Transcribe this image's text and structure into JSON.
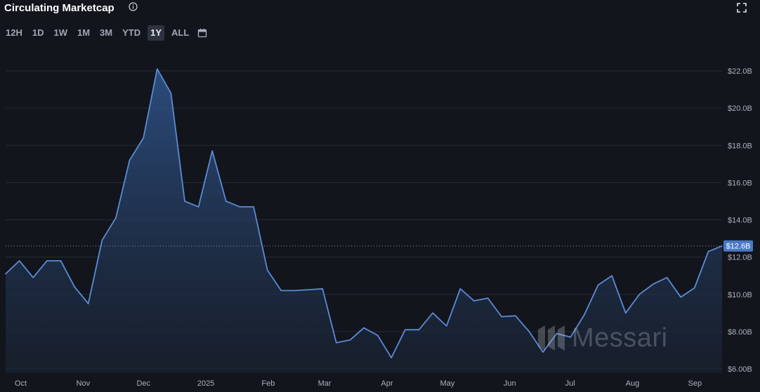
{
  "header": {
    "title": "Circulating Marketcap",
    "info_icon": "info-circle-icon",
    "expand_icon": "fullscreen-icon"
  },
  "range_buttons": [
    "12H",
    "1D",
    "1W",
    "1M",
    "3M",
    "YTD",
    "1Y",
    "ALL"
  ],
  "active_range": "1Y",
  "calendar_icon": "calendar-icon",
  "watermark": {
    "text": "Messari",
    "icon": "messari-logo-icon"
  },
  "colors": {
    "line": "#5b8bd6",
    "fill_top": "#2a4a7a",
    "background": "#12151c",
    "grid": "#262b36",
    "label_bg": "#4a78c6"
  },
  "chart_data": {
    "type": "area",
    "title": "Circulating Marketcap",
    "ylabel": "",
    "xlabel": "",
    "ylim": [
      6.0,
      23.5
    ],
    "ytick_values": [
      6,
      8,
      10,
      12,
      14,
      16,
      18,
      20,
      22
    ],
    "ytick_labels": [
      "$6.00B",
      "$8.00B",
      "$10.0B",
      "$12.0B",
      "$14.0B",
      "$16.0B",
      "$18.0B",
      "$20.0B",
      "$22.0B"
    ],
    "xtick_labels": [
      "Oct",
      "Nov",
      "Dec",
      "2025",
      "Feb",
      "Mar",
      "Apr",
      "May",
      "Jun",
      "Jul",
      "Aug",
      "Sep"
    ],
    "current_value": 12.6,
    "current_label": "$12.6B",
    "grid": true,
    "series": [
      {
        "values": [
          11.1,
          11.8,
          10.9,
          11.8,
          11.8,
          10.4,
          9.5,
          12.9,
          14.1,
          17.2,
          18.4,
          22.1,
          20.8,
          15.0,
          14.7,
          17.7,
          15.0,
          14.7,
          14.7,
          11.3,
          10.2,
          10.2,
          10.25,
          10.3,
          7.4,
          7.55,
          8.2,
          7.8,
          6.6,
          8.1,
          8.1,
          9.0,
          8.3,
          10.3,
          9.65,
          9.8,
          8.8,
          8.85,
          8.0,
          6.9,
          7.9,
          7.7,
          8.9,
          10.5,
          11.0,
          9.0,
          10.0,
          10.55,
          10.9,
          9.85,
          10.35,
          12.3,
          12.6
        ]
      }
    ]
  }
}
